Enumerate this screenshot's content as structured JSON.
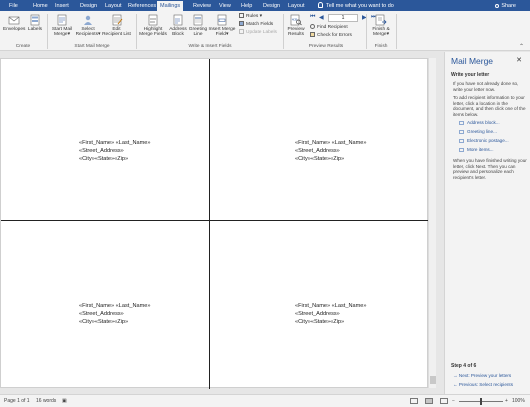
{
  "tabs": [
    "File",
    "Home",
    "Insert",
    "Design",
    "Layout",
    "References",
    "Mailings",
    "Review",
    "View",
    "Help",
    "Design",
    "Layout"
  ],
  "active_tab_index": 6,
  "tell_me": "Tell me what you want to do",
  "share": "Share",
  "ribbon": {
    "create": {
      "envelopes": "Envelopes",
      "labels": "Labels",
      "group": "Create"
    },
    "start": {
      "start_1": "Start Mail",
      "start_2": "Merge",
      "select_1": "Select",
      "select_2": "Recipients",
      "edit_1": "Edit",
      "edit_2": "Recipient List",
      "group": "Start Mail Merge"
    },
    "write": {
      "highlight_1": "Highlight",
      "highlight_2": "Merge Fields",
      "address_1": "Address",
      "address_2": "Block",
      "greeting_1": "Greeting",
      "greeting_2": "Line",
      "insert_1": "Insert Merge",
      "insert_2": "Field",
      "rules": "Rules",
      "match": "Match Fields",
      "update": "Update Labels",
      "group": "Write & Insert Fields"
    },
    "preview": {
      "preview_1": "Preview",
      "preview_2": "Results",
      "record": "1",
      "find": "Find Recipient",
      "check": "Check for Errors",
      "group": "Preview Results"
    },
    "finish": {
      "finish_1": "Finish &",
      "finish_2": "Merge",
      "group": "Finish"
    }
  },
  "labels": [
    {
      "line1": "«First_Name» «Last_Name»",
      "line2": "«Street_Address»",
      "line3": "«City»«State»«Zip»"
    },
    {
      "line1": "«First_Name» «Last_Name»",
      "line2": "«Street_Address»",
      "line3": "«City»«State»«Zip»"
    },
    {
      "line1": "«First_Name» «Last_Name»",
      "line2": "«Street_Address»",
      "line3": "«City»«State»«Zip»"
    },
    {
      "line1": "«First_Name» «Last_Name»",
      "line2": "«Street_Address»",
      "line3": "«City»«State»«Zip»"
    }
  ],
  "pane": {
    "title": "Mail Merge",
    "heading": "Write your letter",
    "para1": "If you have not already done so, write your letter now.",
    "para2": "To add recipient information to your letter, click a location in the document, and then click one of the items below.",
    "links": [
      "Address block...",
      "Greeting line...",
      "Electronic postage...",
      "More items..."
    ],
    "para3": "When you have finished writing your letter, click Next. Then you can preview and personalize each recipient's letter.",
    "step": "Step 4 of 6",
    "next": "Next: Preview your letters",
    "previous": "Previous: Select recipients"
  },
  "status": {
    "page": "Page 1 of 1",
    "words": "16 words",
    "zoom": "100%"
  }
}
